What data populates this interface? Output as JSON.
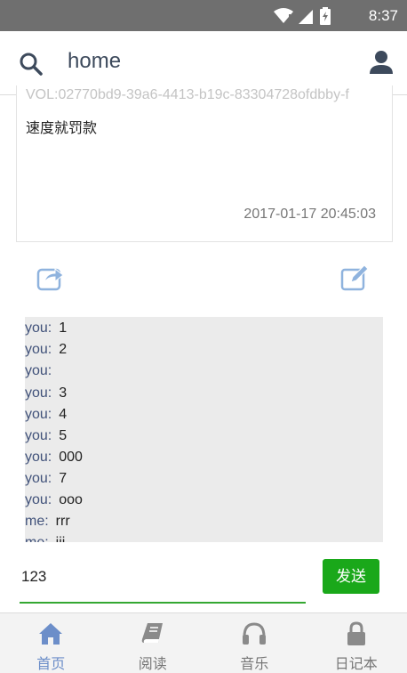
{
  "status_bar": {
    "time": "8:37",
    "icons": [
      "wifi-icon",
      "signal-icon",
      "battery-icon"
    ]
  },
  "app_bar": {
    "title": "home",
    "icons": [
      "search-icon",
      "user-icon"
    ]
  },
  "note": {
    "id_text": "VOL:02770bd9-39a6-4413-b19c-83304728ofdbby-f",
    "content": "速度就罚款",
    "timestamp": "2017-01-17 20:45:03"
  },
  "actions": {
    "icons": [
      "share-icon",
      "edit-icon"
    ]
  },
  "chat": {
    "messages": [
      {
        "sender": "you:",
        "text": "1"
      },
      {
        "sender": "you:",
        "text": "2"
      },
      {
        "sender": "you:",
        "text": ""
      },
      {
        "sender": "you:",
        "text": "3"
      },
      {
        "sender": "you:",
        "text": "4"
      },
      {
        "sender": "you:",
        "text": "5"
      },
      {
        "sender": "you:",
        "text": "000"
      },
      {
        "sender": "you:",
        "text": "7"
      },
      {
        "sender": "you:",
        "text": "ooo"
      },
      {
        "sender": "me:",
        "text": "rrr"
      },
      {
        "sender": "me:",
        "text": "iii"
      }
    ]
  },
  "composer": {
    "input_value": "123",
    "send_label": "发送"
  },
  "bottom_nav": {
    "items": [
      {
        "label": "首页",
        "icon": "home-icon",
        "active": true
      },
      {
        "label": "阅读",
        "icon": "book-icon",
        "active": false
      },
      {
        "label": "音乐",
        "icon": "headphones-icon",
        "active": false
      },
      {
        "label": "日记本",
        "icon": "lock-icon",
        "active": false
      }
    ]
  },
  "colors": {
    "status_bar": "#6f6f6f",
    "title_text": "#3d4a5c",
    "accent_green": "#1aa81a",
    "active_tab": "#6c8ec9",
    "icon_blue": "#8fb3de",
    "chat_bg": "#ebebeb"
  }
}
